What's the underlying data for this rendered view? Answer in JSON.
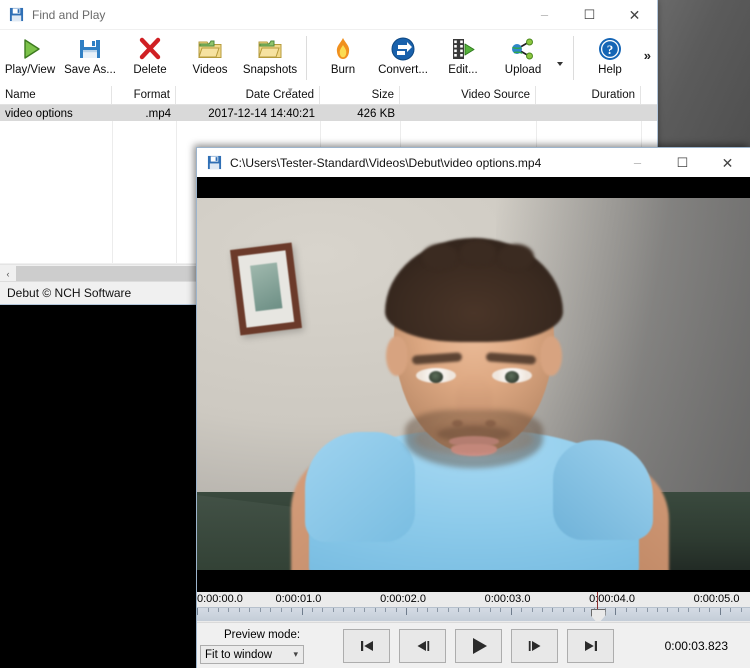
{
  "desktop": {
    "background_color": "#000000",
    "accent_gray": "#5b5b5b"
  },
  "find_and_play_window": {
    "title": "Find and Play",
    "title_icon": "save-disk-icon",
    "window_buttons": {
      "minimize": "–",
      "maximize": "☐",
      "close": "✕"
    },
    "toolbar": {
      "items": [
        {
          "label": "Play/View",
          "icon": "play-triangle-icon"
        },
        {
          "label": "Save As...",
          "icon": "floppy-disk-icon"
        },
        {
          "label": "Delete",
          "icon": "red-x-icon"
        },
        {
          "label": "Videos",
          "icon": "folder-icon"
        },
        {
          "label": "Snapshots",
          "icon": "folder-icon"
        },
        {
          "label": "Burn",
          "icon": "flame-icon"
        },
        {
          "label": "Convert...",
          "icon": "convert-circle-icon"
        },
        {
          "label": "Edit...",
          "icon": "film-strip-icon"
        },
        {
          "label": "Upload",
          "icon": "share-nodes-icon"
        },
        {
          "label": "Help",
          "icon": "question-circle-icon"
        }
      ],
      "overflow_label": "»",
      "dropdown_caret": "dropdown-caret-icon"
    },
    "file_list": {
      "columns": [
        "Name",
        "Format",
        "Date Created",
        "Size",
        "Video Source",
        "Duration"
      ],
      "sort_column": "Date Created",
      "rows": [
        {
          "name": "video options",
          "format": ".mp4",
          "date_created": "2017-12-14 14:40:21",
          "size": "426 KB",
          "video_source": "",
          "duration": ""
        }
      ]
    },
    "scrollbar": {
      "left_arrow": "‹"
    },
    "status_bar": {
      "text": "Debut © NCH Software"
    }
  },
  "player_window": {
    "title": "C:\\Users\\Tester-Standard\\Videos\\Debut\\video options.mp4",
    "title_icon": "save-disk-icon",
    "window_buttons": {
      "minimize": "–",
      "maximize": "☐",
      "close": "✕"
    },
    "timeline": {
      "labels": [
        "0:00:00.0",
        "0:00:01.0",
        "0:00:02.0",
        "0:00:03.0",
        "0:00:04.0",
        "0:00:05.0"
      ],
      "seconds": [
        0,
        1,
        2,
        3,
        4,
        5
      ],
      "playhead_time": "0:00:03.823",
      "playhead_seconds": 3.823,
      "range_seconds": [
        0,
        5.3
      ]
    },
    "controls": {
      "preview_mode_label": "Preview mode:",
      "preview_mode_value": "Fit to window",
      "preview_mode_options": [
        "Fit to window"
      ],
      "buttons": [
        {
          "name": "skip-to-start",
          "glyph": "skip-start-icon"
        },
        {
          "name": "step-back",
          "glyph": "step-back-icon"
        },
        {
          "name": "play",
          "glyph": "play-icon"
        },
        {
          "name": "step-forward",
          "glyph": "step-forward-icon"
        },
        {
          "name": "skip-to-end",
          "glyph": "skip-end-icon"
        }
      ],
      "current_time": "0:00:03.823"
    },
    "video": {
      "description": "webcam video of a man in a light blue t-shirt facing the camera, framed picture on the wall behind him",
      "letterbox_color": "#000000"
    }
  }
}
